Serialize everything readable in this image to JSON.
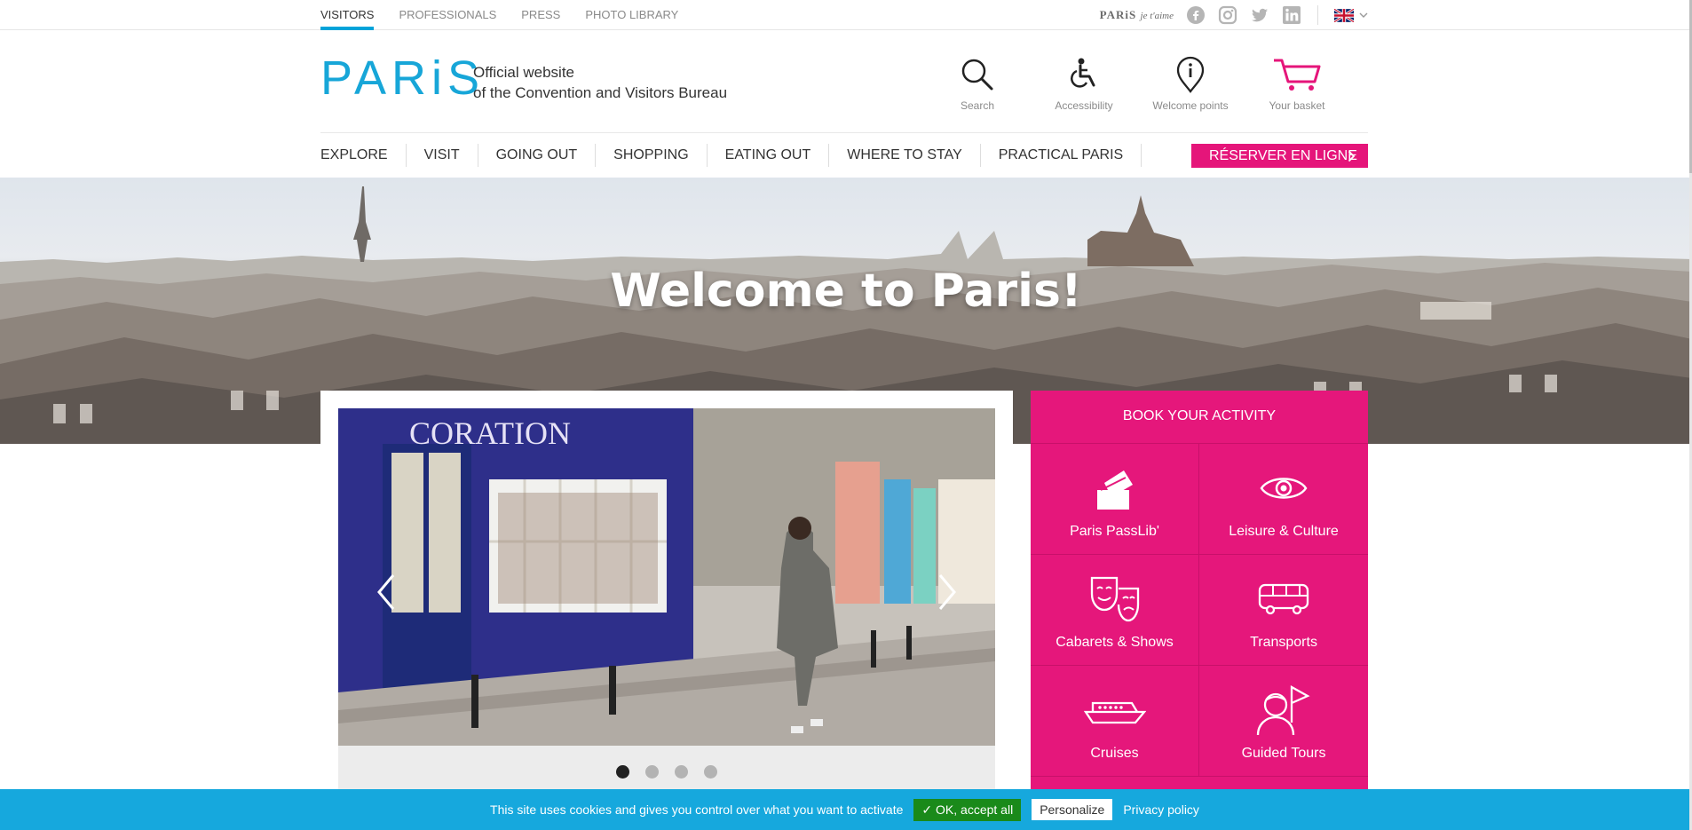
{
  "top_nav": {
    "links": [
      "VISITORS",
      "PROFESSIONALS",
      "PRESS",
      "PHOTO LIBRARY"
    ],
    "brand_logo": "PARiS je t'aime",
    "social_icons": [
      "facebook-icon",
      "instagram-icon",
      "twitter-icon",
      "linkedin-icon"
    ],
    "language": "English (UK flag)"
  },
  "header": {
    "logo": "PARiS",
    "tagline_line1": "Official website",
    "tagline_line2": "of the Convention and Visitors Bureau",
    "icons": [
      {
        "label": "Search",
        "icon": "search-icon"
      },
      {
        "label": "Accessibility",
        "icon": "wheelchair-icon"
      },
      {
        "label": "Welcome points",
        "icon": "info-pin-icon"
      },
      {
        "label": "Your basket",
        "icon": "cart-icon"
      }
    ]
  },
  "main_nav": {
    "items": [
      "EXPLORE",
      "VISIT",
      "GOING OUT",
      "SHOPPING",
      "EATING OUT",
      "WHERE TO STAY",
      "PRACTICAL PARIS"
    ],
    "reserve_button": "RÉSERVER EN LIGNE"
  },
  "hero": {
    "title": "Welcome to Paris!"
  },
  "slider": {
    "slide_sign_text": "CORATION",
    "dots_count": 4,
    "active_dot": 1
  },
  "activity": {
    "heading": "BOOK YOUR ACTIVITY",
    "tiles": [
      {
        "label": "Paris PassLib'",
        "icon": "ticket-icon"
      },
      {
        "label": "Leisure & Culture",
        "icon": "eye-icon"
      },
      {
        "label": "Cabarets & Shows",
        "icon": "theatre-masks-icon"
      },
      {
        "label": "Transports",
        "icon": "bus-icon"
      },
      {
        "label": "Cruises",
        "icon": "boat-icon"
      },
      {
        "label": "Guided Tours",
        "icon": "guide-flag-icon"
      }
    ]
  },
  "cookie_banner": {
    "message": "This site uses cookies and gives you control over what you want to activate",
    "ok_button": "✓ OK, accept all",
    "personalize_button": "Personalize",
    "privacy_link": "Privacy policy"
  }
}
